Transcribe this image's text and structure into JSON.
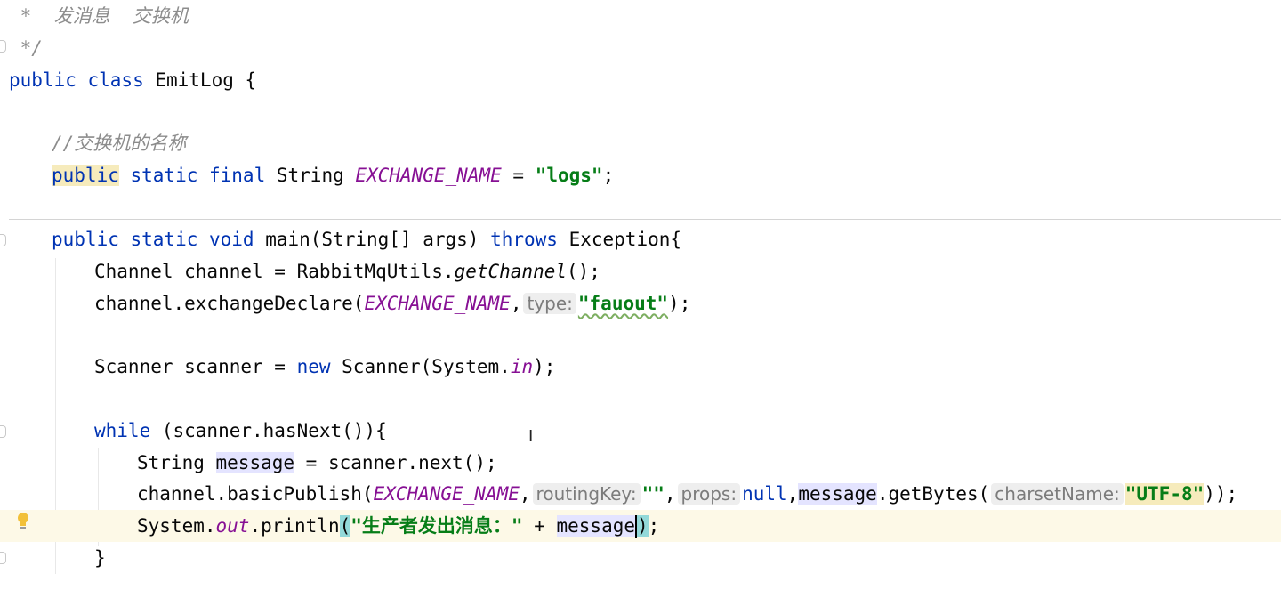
{
  "editor": {
    "comment_line1": " *  发消息  交换机",
    "comment_line2": " */",
    "class_kw": "public class",
    "class_name": " EmitLog {",
    "comment_exchange": "//交换机的名称",
    "field_public": "public",
    "field_mods": " static final ",
    "field_type": "String ",
    "field_name": "EXCHANGE_NAME",
    "field_eq": " = ",
    "field_value": "\"logs\"",
    "field_end": ";",
    "main_mods": "public static void",
    "main_sig": " main(String[] args) ",
    "main_throws": "throws",
    "main_exc": " Exception{",
    "l_channel_a": "Channel channel = RabbitMqUtils.",
    "l_channel_b": "getChannel",
    "l_channel_c": "();",
    "l_decl_a": "channel.exchangeDeclare(",
    "l_decl_const": "EXCHANGE_NAME",
    "l_decl_comma": ",",
    "hint_type": "type:",
    "l_decl_str": "\"fauout\"",
    "l_decl_end": ");",
    "l_scan_a": "Scanner scanner = ",
    "l_scan_new": "new",
    "l_scan_b": " Scanner(System.",
    "l_scan_in": "in",
    "l_scan_c": ");",
    "l_while_kw": "while",
    "l_while_b": " (scanner.hasNext()){",
    "l_msg_a": "String ",
    "l_msg_var": "message",
    "l_msg_b": " = scanner.next();",
    "l_pub_a": "channel.basicPublish(",
    "l_pub_const": "EXCHANGE_NAME",
    "l_pub_comma": ",",
    "hint_routing": "routingKey:",
    "l_pub_empty": "\"\"",
    "l_pub_comma2": ",",
    "hint_props": "props:",
    "l_pub_null": "null",
    "l_pub_comma3": ",",
    "l_pub_msg": "message",
    "l_pub_getbytes": ".getBytes(",
    "hint_charset": "charsetName:",
    "l_pub_utf": "\"UTF-8\"",
    "l_pub_end": "));",
    "l_print_a": "System.",
    "l_print_out": "out",
    "l_print_b": ".println",
    "l_print_paren": "(",
    "l_print_str": "\"生产者发出消息：\"",
    "l_print_plus": " + ",
    "l_print_msg": "message",
    "l_print_close": ")",
    "l_print_end": ";",
    "l_close_brace": "}"
  },
  "colors": {
    "keyword": "#0033b3",
    "string": "#067d17",
    "comment": "#8c8c8c",
    "constant": "#871094",
    "caret_line": "#fdf9e7"
  },
  "icons": [
    "lightbulb-icon",
    "fold-marker-icon"
  ]
}
